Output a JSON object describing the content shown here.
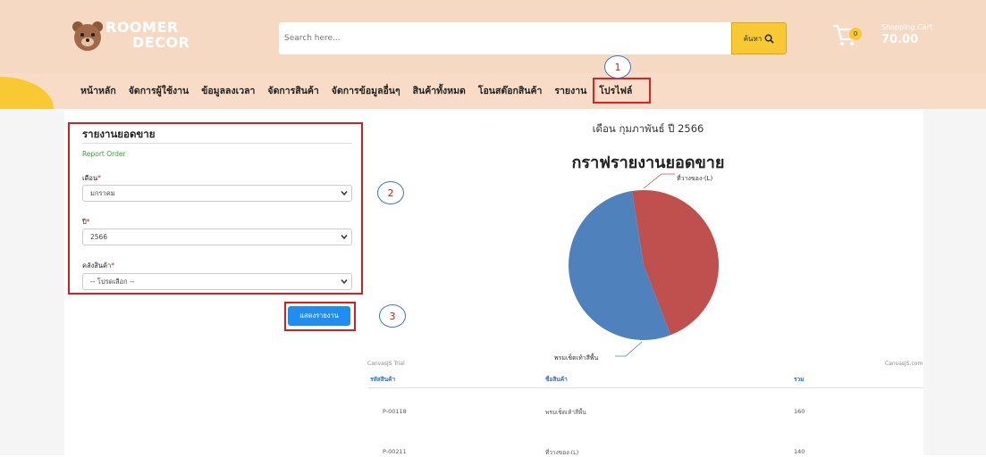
{
  "header": {
    "logo_line1": "ROOMER",
    "logo_line2": "DECOR",
    "search_placeholder": "Search here...",
    "search_button": "ค้นหา",
    "cart_badge": "0",
    "cart_label": "Shopping Cart",
    "cart_total": "70.00"
  },
  "nav": {
    "items": [
      "หน้าหลัก",
      "จัดการผู้ใช้งาน",
      "ข้อมูลลงเวลา",
      "จัดการสินค้า",
      "จัดการข้อมูลอื่นๆ",
      "สินค้าทั้งหมด",
      "โอนสต๊อกสินค้า",
      "รายงาน",
      "โปรไฟล์"
    ]
  },
  "markers": [
    "1",
    "2",
    "3"
  ],
  "form": {
    "title": "รายงานยอดขาย",
    "subtitle": "Report Order",
    "month_label": "เดือน",
    "month_value": "มกราคม",
    "year_label": "ปี",
    "year_value": "2566",
    "warehouse_label": "คลังสินค้า",
    "warehouse_value": "-- โปรดเลือก --",
    "required_mark": "*",
    "submit_label": "แสดงรายงาน"
  },
  "report": {
    "month_title": "เดือน กุมภาพันธ์ ปี 2566",
    "chart_title": "กราฟรายงานยอดขาย",
    "canvas_trial": "CanvasJS Trial",
    "canvas_com": "CanvasJS.com"
  },
  "chart_data": {
    "type": "pie",
    "title": "กราฟรายงานยอดขาย",
    "slices": [
      {
        "label": "ที่วางของ-(L)",
        "value": 140,
        "color": "#c0504d"
      },
      {
        "label": "พรมเช็ดเท้าสีพื้น",
        "value": 160,
        "color": "#4f81bd"
      }
    ]
  },
  "table": {
    "headers": [
      "รหัสสินค้า",
      "ชื่อสินค้า",
      "รวม"
    ],
    "rows": [
      [
        "P-00118",
        "พรมเช็ดเท้าสีพื้น",
        "160"
      ],
      [
        "P-00211",
        "ที่วางของ-(L)",
        "140"
      ]
    ]
  }
}
